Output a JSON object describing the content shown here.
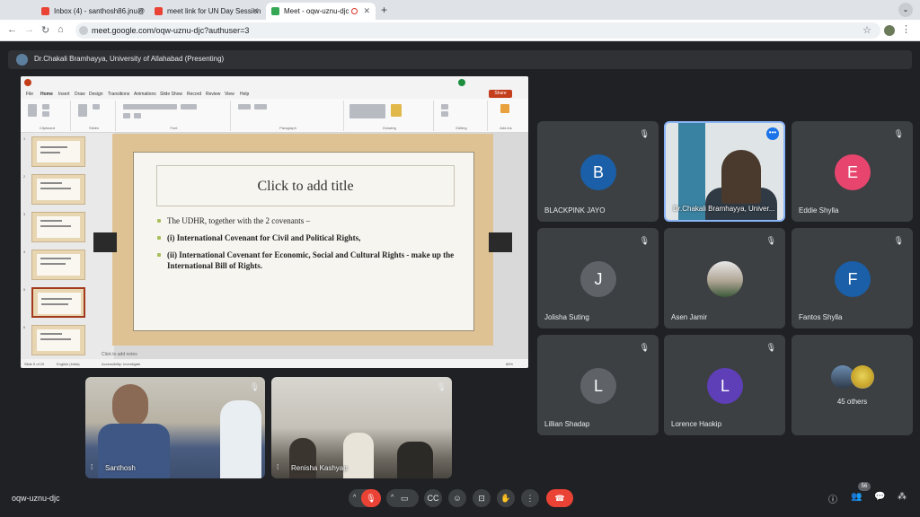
{
  "browser": {
    "tabs": [
      {
        "label": "Inbox (4) - santhosh86.jnu@",
        "fav_color": "#ea4335"
      },
      {
        "label": "meet link for UN Day Session",
        "fav_color": "#ea4335"
      },
      {
        "label": "Meet - oqw-uznu-djc",
        "fav_color": "#34a853"
      }
    ],
    "close_glyph": "✕",
    "new_tab_glyph": "+",
    "url": "meet.google.com/oqw-uznu-djc?authuser=3"
  },
  "presenting": {
    "label": "Dr.Chakali Bramhayya, University of Allahabad (Presenting)"
  },
  "powerpoint": {
    "menu": [
      "File",
      "Home",
      "Insert",
      "Draw",
      "Design",
      "Transitions",
      "Animations",
      "Slide Show",
      "Record",
      "Review",
      "View",
      "Help"
    ],
    "share_label": "Share",
    "ribbon_groups": [
      "Clipboard",
      "Slides",
      "Font",
      "Paragraph",
      "Drawing",
      "Editing",
      "Add-ins"
    ],
    "slide": {
      "title": "Click to add title",
      "bullets": [
        {
          "text": "The UDHR, together with the 2 covenants –",
          "bold": false
        },
        {
          "text": "(i) International Covenant for Civil and Political Rights,",
          "bold": true
        },
        {
          "text": "(ii) International Covenant for Economic, Social and Cultural Rights - make up the International Bill of Rights.",
          "bold": true
        }
      ]
    },
    "notes_placeholder": "Click to add notes",
    "status_left": "Slide 5 of 20",
    "status_lang": "English (India)",
    "status_access": "Accessibility: Investigate",
    "status_zoom": "86%"
  },
  "local_videos": [
    {
      "name": "Santhosh"
    },
    {
      "name": "Renisha Kashyap"
    }
  ],
  "participants": [
    {
      "name": "BLACKPINK JAYO",
      "initial": "B",
      "color": "#1a5fa8"
    },
    {
      "name": "Dr.Chakali Bramhayya, Univer...",
      "initial": "",
      "color": ""
    },
    {
      "name": "Eddie Shylla",
      "initial": "E",
      "color": "#e8456e"
    },
    {
      "name": "Jolisha Suting",
      "initial": "J",
      "color": "#5f6368"
    },
    {
      "name": "Asen Jamir",
      "initial": "",
      "color": ""
    },
    {
      "name": "Fantos Shylla",
      "initial": "F",
      "color": "#1a5fa8"
    },
    {
      "name": "Lillian Shadap",
      "initial": "L",
      "color": "#5f6368"
    },
    {
      "name": "Lorence Haokip",
      "initial": "L",
      "color": "#5e3fb8"
    },
    {
      "name": "45 others",
      "initial": "",
      "color": ""
    }
  ],
  "bottom": {
    "meeting_code": "oqw-uznu-djc",
    "participant_count": "56",
    "controls": [
      "mic-off",
      "camera",
      "captions",
      "emoji",
      "present",
      "raise-hand",
      "more",
      "leave-call"
    ]
  }
}
